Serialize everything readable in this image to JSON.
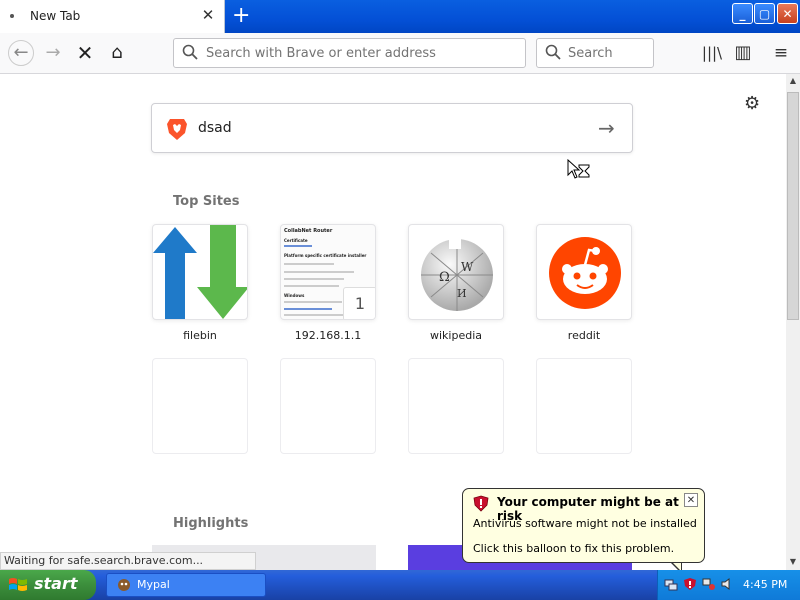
{
  "tab": {
    "title": "New Tab",
    "close_glyph": "✕"
  },
  "tabbar": {
    "new_tab_glyph": "+"
  },
  "window_controls": {
    "minimize": "_",
    "maximize": "▢",
    "close": "✕"
  },
  "toolbar": {
    "back_glyph": "←",
    "forward_glyph": "→",
    "stop_glyph": "✕",
    "home_glyph": "⌂",
    "url_placeholder": "Search with Brave or enter address",
    "search_placeholder": "Search",
    "library_glyph": "|||\\",
    "sidebar_glyph": "▥",
    "menu_glyph": "≡"
  },
  "page": {
    "settings_glyph": "⚙",
    "search_value": "dsad",
    "search_arrow": "→",
    "top_sites_title": "Top Sites",
    "highlights_title": "Highlights",
    "top_sites": [
      {
        "label": "filebin",
        "icon": "filebin-icon"
      },
      {
        "label": "192.168.1.1",
        "icon": "page-thumbnail",
        "badge": "1",
        "thumb_heading": "CollabNet Router",
        "thumb_sub": "Certificate",
        "thumb_title": "Platform specific certificate installer",
        "thumb_section": "Windows"
      },
      {
        "label": "wikipedia",
        "icon": "wikipedia-icon"
      },
      {
        "label": "reddit",
        "icon": "reddit-icon"
      }
    ]
  },
  "status": {
    "text": "Waiting for safe.search.brave.com..."
  },
  "balloon": {
    "title": "Your computer might be at risk",
    "line1": "Antivirus software might not be installed",
    "line2": "Click this balloon to fix this problem.",
    "close_glyph": "✕"
  },
  "taskbar": {
    "start_label": "start",
    "task_label": "Mypal",
    "clock": "4:45 PM"
  },
  "colors": {
    "taskbar": "#245edb",
    "start": "#3c8e3c",
    "balloon": "#ffffe1",
    "brave": "#fb542b",
    "reddit": "#ff4500"
  }
}
